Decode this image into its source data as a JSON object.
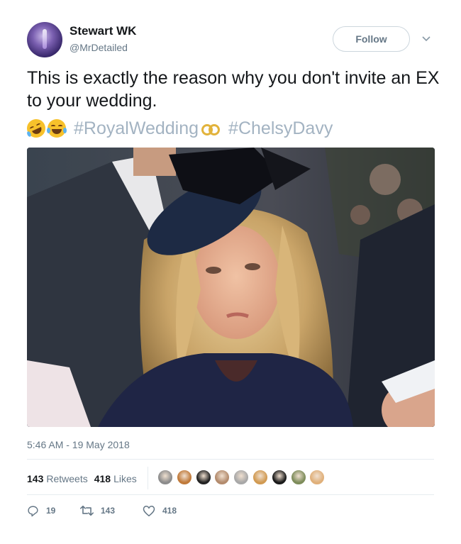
{
  "user": {
    "display_name": "Stewart WK",
    "handle": "@MrDetailed"
  },
  "follow_button": {
    "label": "Follow"
  },
  "tweet": {
    "text": "This is exactly the reason why you don't invite an EX to your wedding.",
    "hashtags": [
      "#RoyalWedding",
      "#ChelsyDavy"
    ],
    "emojis": [
      "rolling-on-floor-laughing",
      "face-with-tears-of-joy",
      "rings"
    ]
  },
  "timestamp": "5:46 AM - 19 May 2018",
  "stats": {
    "retweets_count": "143",
    "retweets_label": "Retweets",
    "likes_count": "418",
    "likes_label": "Likes"
  },
  "liker_avatars": [
    {
      "color": "#8c8c8c"
    },
    {
      "color": "#c07a3a"
    },
    {
      "color": "#222222"
    },
    {
      "color": "#b38b6d"
    },
    {
      "color": "#a8a8a8"
    },
    {
      "color": "#d19a52"
    },
    {
      "color": "#1a1a1a"
    },
    {
      "color": "#7d8c5a"
    },
    {
      "color": "#e0b07a"
    }
  ],
  "actions": {
    "reply_count": "19",
    "retweet_count": "143",
    "like_count": "418"
  },
  "colors": {
    "text": "#14171a",
    "secondary": "#657786",
    "hashtag": "#a3b3c2",
    "border": "#e6ecf0"
  }
}
